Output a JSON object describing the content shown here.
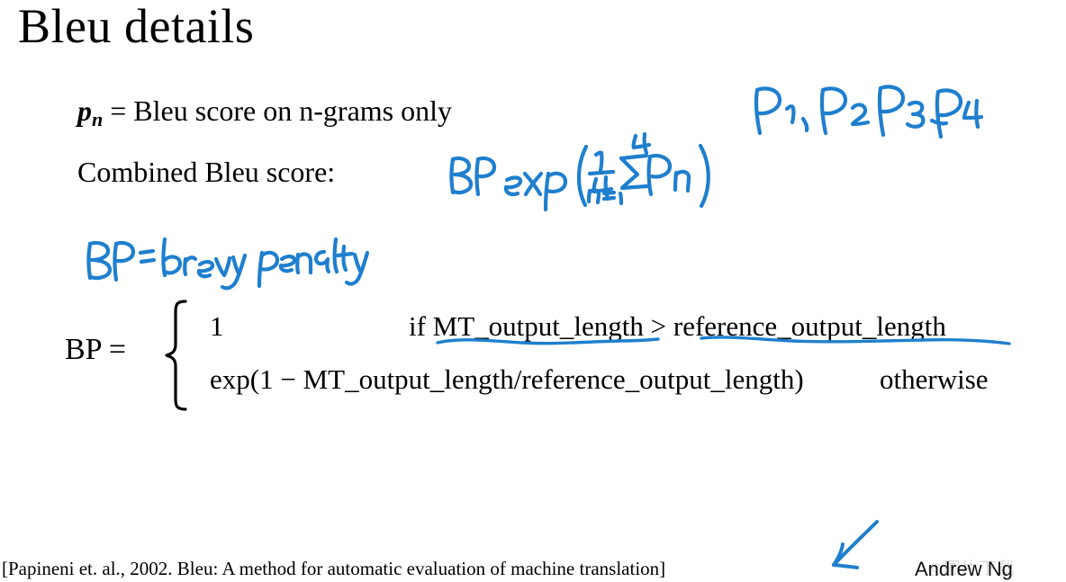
{
  "slide": {
    "title": "Bleu details",
    "background_color": "#ffffff",
    "text_color": "#000000",
    "ink_color": "#1f7fce"
  },
  "body": {
    "pn_definition": {
      "symbol": "p",
      "subscript": "n",
      "equals_text": " = Bleu score on n-grams only"
    },
    "combined_label": "Combined Bleu score:"
  },
  "bp_equation": {
    "label": "BP =",
    "case1_value": "1",
    "case1_condition": "if MT_output_length > reference_output_length",
    "case2_value": "exp(1 − MT_output_length/reference_output_length)",
    "case2_condition": "otherwise"
  },
  "annotations": {
    "p_list": "P₁, P₂, P₃, P₄",
    "combined_formula": "BP exp(1/4 Σ n=1 to 4  Pₙ)",
    "bp_definition": "BP = brevity penalty",
    "underline_1_target": "MT_output_length",
    "underline_2_target": "reference_output_length",
    "arrow_target": "citation"
  },
  "footer": {
    "citation": "[Papineni et. al., 2002. Bleu: A method for automatic evaluation of machine translation]",
    "presenter": "Andrew Ng",
    "watermark": "◎图片下载"
  }
}
